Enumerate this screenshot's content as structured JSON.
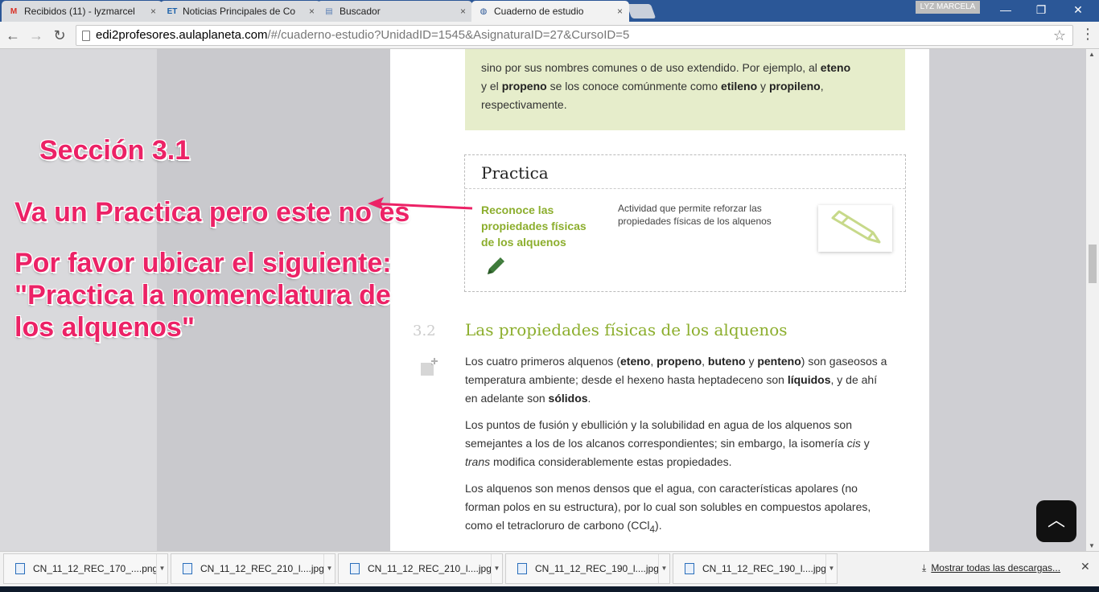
{
  "browser": {
    "tabs": [
      {
        "label": "Recibidos (11) - lyzmarcel",
        "icon": "gmail-icon",
        "glyph": "M",
        "glyph_color": "#d93025",
        "active": false
      },
      {
        "label": "Noticias Principales de Co",
        "icon": "news-icon",
        "glyph": "ET",
        "glyph_color": "#1a5fa8",
        "active": false
      },
      {
        "label": "Buscador",
        "icon": "page-icon",
        "glyph": "▤",
        "glyph_color": "#5b7fb5",
        "active": false
      },
      {
        "label": "Cuaderno de estudio",
        "icon": "globe-icon",
        "glyph": "◍",
        "glyph_color": "#2b5797",
        "active": true
      }
    ],
    "close_glyph": "×",
    "user_name": "LYZ MARCELA",
    "window_buttons": {
      "minimize": "—",
      "maximize": "❐",
      "close": "✕"
    },
    "nav": {
      "back": "←",
      "forward": "→",
      "reload": "↻"
    },
    "url_host": "edi2profesores.aulaplaneta.com",
    "url_path": "/#/cuaderno-estudio?UnidadID=1545&AsignaturaID=27&CursoID=5",
    "bookmark_star": "☆",
    "menu": "⋮"
  },
  "content": {
    "green_box": {
      "line1_prefix": "sino por sus nombres comunes o de uso extendido. Por ejemplo, al ",
      "line1_bold": "eteno",
      "line2_prefix": "y el ",
      "line2_bold1": "propeno",
      "line2_mid": " se los conoce comúnmente como ",
      "line2_bold2": "etileno",
      "line2_and": " y ",
      "line2_bold3": "propileno",
      "line2_suffix": ",",
      "line3": "respectivamente."
    },
    "practica": {
      "title": "Practica",
      "link": "Reconoce las propiedades físicas de los alquenos",
      "description": "Actividad que permite reforzar las propiedades físicas de los alquenos"
    },
    "section": {
      "number": "3.2",
      "title": "Las propiedades físicas de los alquenos"
    },
    "p1": {
      "a": "Los cuatro primeros alquenos (",
      "b1": "eteno",
      "c": ", ",
      "b2": "propeno",
      "d": ", ",
      "b3": "buteno",
      "e": " y ",
      "b4": "penteno",
      "f": ") son gaseosos a temperatura ambiente; desde el hexeno hasta heptadeceno son ",
      "b5": "líquidos",
      "g": ", y de ahí en adelante son ",
      "b6": "sólidos",
      "h": "."
    },
    "p2": {
      "a": "Los puntos de fusión y ebullición y la solubilidad en agua de los alquenos son semejantes a los de los alcanos correspondientes; sin embargo, la isomería ",
      "i1": "cis",
      "b": " y ",
      "i2": "trans",
      "c": " modifica considerablemente estas propiedades."
    },
    "p3": {
      "a": "Los alquenos son menos densos que el agua, con características apolares (no forman polos en su estructura), por lo cual son solubles en compuestos apolares, como el tetracloruro de carbono (CCl",
      "sub": "4",
      "b": ")."
    },
    "scroll_top": "︿"
  },
  "annotations": {
    "section_label": "Sección 3.1",
    "line1": "Va un Practica pero este no es",
    "line2": "Por favor ubicar el siguiente: \"Practica la nomenclatura de los alquenos\"",
    "color": "#ec2266"
  },
  "downloads": {
    "files": [
      "CN_11_12_REC_170_....png",
      "CN_11_12_REC_210_l....jpg",
      "CN_11_12_REC_210_l....jpg",
      "CN_11_12_REC_190_l....jpg",
      "CN_11_12_REC_190_l....jpg"
    ],
    "dropdown_glyph": "▼",
    "download_glyph": "⤓",
    "show_all": "Mostrar todas las descargas...",
    "close": "✕"
  }
}
